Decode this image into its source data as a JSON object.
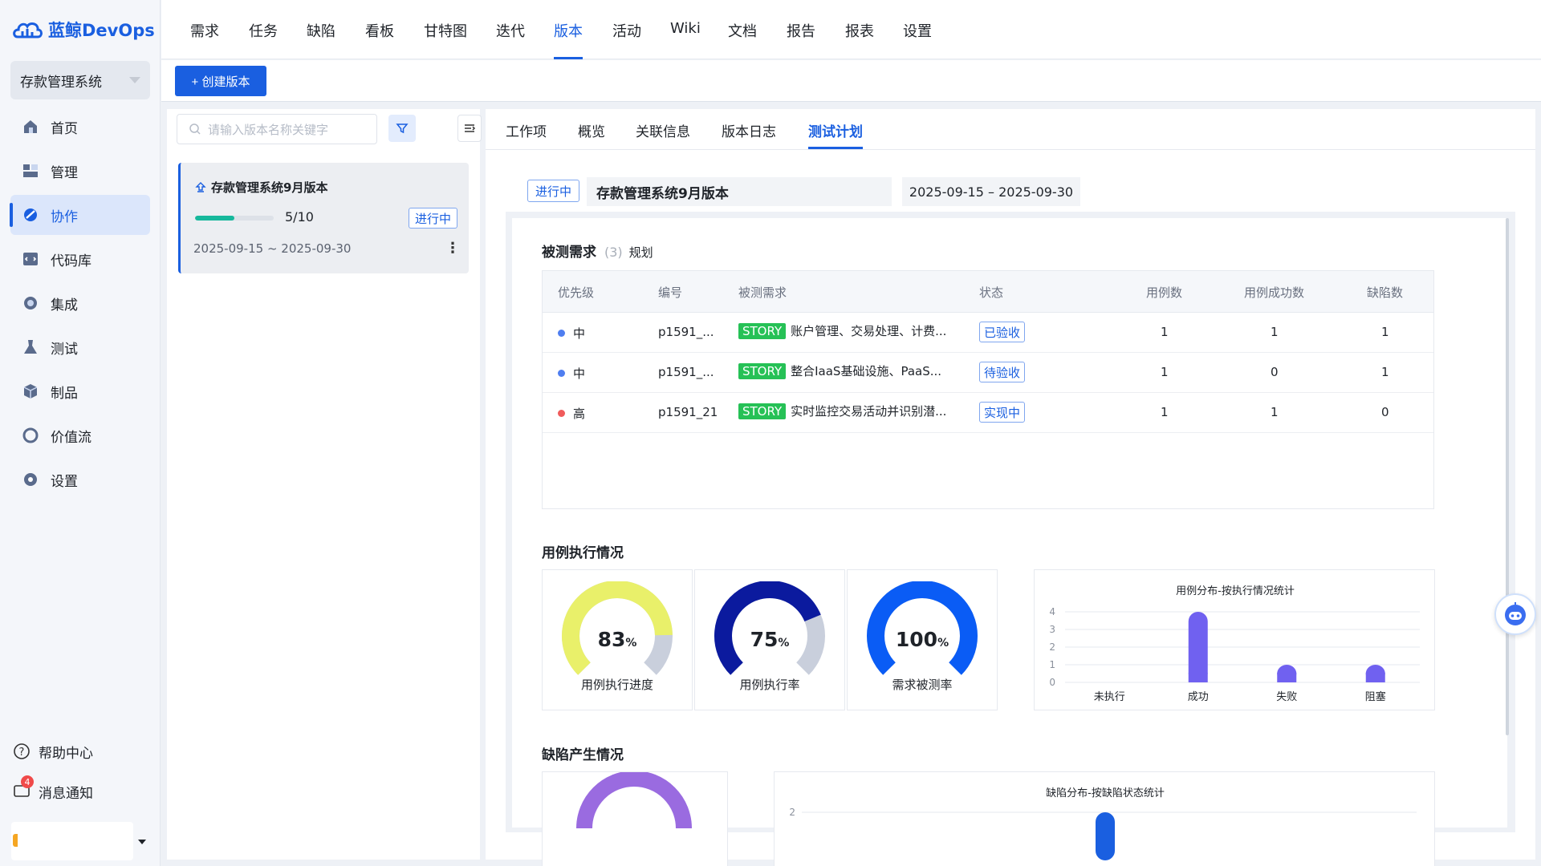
{
  "app": {
    "logo_text": "蓝鲸DevOps",
    "project": "存款管理系统"
  },
  "sidebar": {
    "items": [
      {
        "label": "首页",
        "icon": "home-icon"
      },
      {
        "label": "管理",
        "icon": "manage-icon"
      },
      {
        "label": "协作",
        "icon": "collab-icon",
        "active": true
      },
      {
        "label": "代码库",
        "icon": "repo-icon"
      },
      {
        "label": "集成",
        "icon": "integration-icon"
      },
      {
        "label": "测试",
        "icon": "flask-icon"
      },
      {
        "label": "制品",
        "icon": "artifact-icon"
      },
      {
        "label": "价值流",
        "icon": "valuestream-icon"
      },
      {
        "label": "设置",
        "icon": "gear-icon"
      }
    ],
    "help": "帮助中心",
    "notify": "消息通知",
    "notify_badge": "4"
  },
  "topnav": {
    "items": [
      "需求",
      "任务",
      "缺陷",
      "看板",
      "甘特图",
      "迭代",
      "版本",
      "活动",
      "Wiki",
      "文档",
      "报告",
      "报表",
      "设置"
    ],
    "active": "版本"
  },
  "toolbar": {
    "create_label": "+ 创建版本"
  },
  "release_list": {
    "search_placeholder": "请输入版本名称关键字",
    "card": {
      "title": "存款管理系统9月版本",
      "progress": 0.5,
      "count": "5/10",
      "status": "进行中",
      "date_range": "2025-09-15 ~ 2025-09-30",
      "more": "⋮"
    }
  },
  "detail": {
    "tabs": [
      "工作项",
      "概览",
      "关联信息",
      "版本日志",
      "测试计划"
    ],
    "active_tab": "测试计划",
    "status": "进行中",
    "title": "存款管理系统9月版本",
    "date_range": "2025-09-15 – 2025-09-30",
    "requirements": {
      "title": "被测需求",
      "count": "(3)",
      "link": "规划",
      "columns": [
        "优先级",
        "编号",
        "被测需求",
        "状态",
        "用例数",
        "用例成功数",
        "缺陷数"
      ],
      "rows": [
        {
          "priority": "中",
          "priority_color": "#4f7ef0",
          "id": "p1591_...",
          "tag": "STORY",
          "name": "账户管理、交易处理、计费...",
          "state": "已验收",
          "cases": "1",
          "success": "1",
          "defects": "1"
        },
        {
          "priority": "中",
          "priority_color": "#4f7ef0",
          "id": "p1591_...",
          "tag": "STORY",
          "name": "整合IaaS基础设施、PaaS...",
          "state": "待验收",
          "cases": "1",
          "success": "0",
          "defects": "1"
        },
        {
          "priority": "高",
          "priority_color": "#f05b5b",
          "id": "p1591_21",
          "tag": "STORY",
          "name": "实时监控交易活动并识别潜...",
          "state": "实现中",
          "cases": "1",
          "success": "1",
          "defects": "0"
        }
      ]
    },
    "execution": {
      "title": "用例执行情况",
      "gauges": [
        {
          "value": "83",
          "unit": "%",
          "label": "用例执行进度",
          "fraction": 0.83,
          "color": "#e9f06a"
        },
        {
          "value": "75",
          "unit": "%",
          "label": "用例执行率",
          "fraction": 0.75,
          "color": "#0b1a9e"
        },
        {
          "value": "100",
          "unit": "%",
          "label": "需求被测率",
          "fraction": 1.0,
          "color": "#0a5cf5"
        }
      ]
    },
    "defects": {
      "title": "缺陷产生情况"
    }
  },
  "chart_data": [
    {
      "type": "bar",
      "title": "用例分布-按执行情况统计",
      "categories": [
        "未执行",
        "成功",
        "失败",
        "阻塞"
      ],
      "values": [
        0,
        4,
        1,
        1
      ],
      "ylim": [
        0,
        4
      ],
      "yticks": [
        "0",
        "1",
        "2",
        "3",
        "4"
      ],
      "color": "#7061f0",
      "grid": true
    },
    {
      "type": "bar",
      "title": "缺陷分布-按缺陷状态统计",
      "yticks": [
        "2"
      ],
      "color": "#1a5fe0"
    }
  ]
}
